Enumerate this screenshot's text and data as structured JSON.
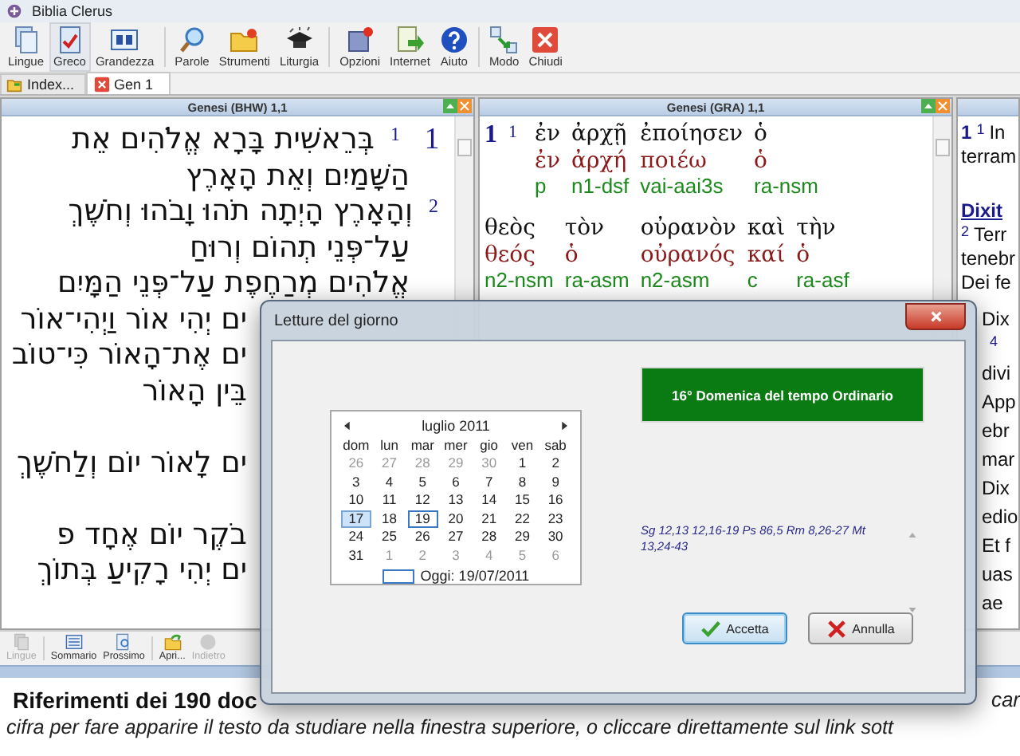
{
  "window": {
    "title": "Biblia Clerus"
  },
  "toolbar": {
    "groups": [
      [
        {
          "label": "Lingue",
          "pressed": false
        },
        {
          "label": "Greco",
          "pressed": true
        },
        {
          "label": "Grandezza",
          "pressed": false
        }
      ],
      [
        {
          "label": "Parole",
          "pressed": false
        },
        {
          "label": "Strumenti",
          "pressed": false
        },
        {
          "label": "Liturgia",
          "pressed": false
        }
      ],
      [
        {
          "label": "Opzioni",
          "pressed": false
        },
        {
          "label": "Internet",
          "pressed": false
        },
        {
          "label": "Aiuto",
          "pressed": false
        }
      ],
      [
        {
          "label": "Modo",
          "pressed": false
        },
        {
          "label": "Chiudi",
          "pressed": false
        }
      ]
    ]
  },
  "tabs": [
    {
      "label": "Index...",
      "selected": false
    },
    {
      "label": "Gen 1",
      "selected": true
    }
  ],
  "hebrew_panel": {
    "title": "Genesi (BHW) 1,1",
    "lines": [
      {
        "kind": "full",
        "chapter": "1",
        "verse": "1",
        "text": "בְּרֵאשִׁית בָּרָא אֱלֹהִים אֵת"
      },
      {
        "kind": "full",
        "text": "הַשָּׁמַיִם וְאֵת הָאָרֶץ"
      },
      {
        "kind": "full",
        "verse": "2",
        "text": "וְהָאָרֶץ הָיְתָה תֹהוּ וָבֹהוּ וְחֹשֶׁךְ"
      },
      {
        "kind": "full",
        "text": "עַל־פְּנֵי תְהוֹם וְרוּחַ"
      },
      {
        "kind": "full",
        "text": "אֱלֹהִים מְרַחֶפֶת עַל־פְּנֵי הַמָּיִם"
      },
      {
        "kind": "partial",
        "text": "ים יְהִי אוֹר וַיְהִי־אוֹר"
      },
      {
        "kind": "partial",
        "text": "ים אֶת־הָאוֹר כִּי־טוֹב"
      },
      {
        "kind": "partial",
        "text": "בֵּין הָאוֹר"
      },
      {
        "kind": "blank"
      },
      {
        "kind": "partial",
        "text": "ים לָאוֹר יוֹם וְלַחֹשֶׁךְ"
      },
      {
        "kind": "blank"
      },
      {
        "kind": "partial",
        "text": "בֹקֶר יוֹם אֶחָד פ"
      },
      {
        "kind": "partial",
        "text": "ים יְהִי רָקִיעַ בְּתוֹךְ"
      }
    ]
  },
  "greek_panel": {
    "title": "Genesi (GRA) 1,1",
    "groups": [
      {
        "chapter": "1",
        "verse": "1",
        "words": [
          {
            "form": "ἐν",
            "lemma": "ἐν",
            "parse": "p"
          },
          {
            "form": "ἀρχῇ",
            "lemma": "ἀρχή",
            "parse": "n1-dsf"
          },
          {
            "form": "ἐποίησεν",
            "lemma": "ποιέω",
            "parse": "vai-aai3s"
          },
          {
            "form": "ὁ",
            "lemma": "ὁ",
            "parse": "ra-nsm"
          }
        ]
      },
      {
        "words": [
          {
            "form": "θεὸς",
            "lemma": "θεός",
            "parse": "n2-nsm"
          },
          {
            "form": "τὸν",
            "lemma": "ὁ",
            "parse": "ra-asm"
          },
          {
            "form": "οὐρανὸν",
            "lemma": "οὐρανός",
            "parse": "n2-asm"
          },
          {
            "form": "καὶ",
            "lemma": "καί",
            "parse": "c"
          },
          {
            "form": "τὴν",
            "lemma": "ὁ",
            "parse": "ra-asf"
          }
        ]
      }
    ]
  },
  "latin_panel": {
    "lines": [
      {
        "kind": "verse",
        "chapter": "1",
        "verse": "1",
        "text": "In"
      },
      {
        "kind": "text",
        "text": "terram"
      },
      {
        "kind": "heading",
        "text": "Dixit"
      },
      {
        "kind": "verse",
        "verse": "2",
        "text": "Terr"
      },
      {
        "kind": "text",
        "text": "tenebr"
      },
      {
        "kind": "text",
        "text": "Dei fe"
      },
      {
        "kind": "fragment",
        "text": "Dix"
      },
      {
        "kind": "number",
        "text": "4"
      },
      {
        "kind": "fragment",
        "text": "divi"
      },
      {
        "kind": "fragment",
        "text": "App"
      },
      {
        "kind": "fragment",
        "text": "ebr"
      },
      {
        "kind": "fragment",
        "text": "mar"
      },
      {
        "kind": "fragment",
        "text": "Dix"
      },
      {
        "kind": "fragment",
        "text": "edio"
      },
      {
        "kind": "fragment",
        "text": "Et f"
      },
      {
        "kind": "fragment",
        "text": "uas"
      },
      {
        "kind": "fragment",
        "text": "ae"
      }
    ]
  },
  "bottom_toolbar": {
    "groups": [
      [
        {
          "label": "Lingue",
          "disabled": true
        }
      ],
      [
        {
          "label": "Sommario",
          "disabled": false
        },
        {
          "label": "Prossimo",
          "disabled": false
        }
      ],
      [
        {
          "label": "Apri...",
          "disabled": false
        },
        {
          "label": "Indietro",
          "disabled": true
        }
      ]
    ]
  },
  "footer": {
    "heading": "Riferimenti dei 190 doc",
    "heading_tail": "car",
    "text": "cifra per fare apparire il testo da studiare nella finestra superiore, o cliccare direttamente sul link sott"
  },
  "dialog": {
    "title": "Letture del giorno",
    "calendar": {
      "month": "luglio 2011",
      "weekdays": [
        "dom",
        "lun",
        "mar",
        "mer",
        "gio",
        "ven",
        "sab"
      ],
      "weeks": [
        [
          {
            "day": "26",
            "other_month": true,
            "selected": false,
            "today": false
          },
          {
            "day": "27",
            "other_month": true,
            "selected": false,
            "today": false
          },
          {
            "day": "28",
            "other_month": true,
            "selected": false,
            "today": false
          },
          {
            "day": "29",
            "other_month": true,
            "selected": false,
            "today": false
          },
          {
            "day": "30",
            "other_month": true,
            "selected": false,
            "today": false
          },
          {
            "day": "1",
            "other_month": false,
            "selected": false,
            "today": false
          },
          {
            "day": "2",
            "other_month": false,
            "selected": false,
            "today": false
          }
        ],
        [
          {
            "day": "3",
            "other_month": false,
            "selected": false,
            "today": false
          },
          {
            "day": "4",
            "other_month": false,
            "selected": false,
            "today": false
          },
          {
            "day": "5",
            "other_month": false,
            "selected": false,
            "today": false
          },
          {
            "day": "6",
            "other_month": false,
            "selected": false,
            "today": false
          },
          {
            "day": "7",
            "other_month": false,
            "selected": false,
            "today": false
          },
          {
            "day": "8",
            "other_month": false,
            "selected": false,
            "today": false
          },
          {
            "day": "9",
            "other_month": false,
            "selected": false,
            "today": false
          }
        ],
        [
          {
            "day": "10",
            "other_month": false,
            "selected": false,
            "today": false
          },
          {
            "day": "11",
            "other_month": false,
            "selected": false,
            "today": false
          },
          {
            "day": "12",
            "other_month": false,
            "selected": false,
            "today": false
          },
          {
            "day": "13",
            "other_month": false,
            "selected": false,
            "today": false
          },
          {
            "day": "14",
            "other_month": false,
            "selected": false,
            "today": false
          },
          {
            "day": "15",
            "other_month": false,
            "selected": false,
            "today": false
          },
          {
            "day": "16",
            "other_month": false,
            "selected": false,
            "today": false
          }
        ],
        [
          {
            "day": "17",
            "other_month": false,
            "selected": true,
            "today": false
          },
          {
            "day": "18",
            "other_month": false,
            "selected": false,
            "today": false
          },
          {
            "day": "19",
            "other_month": false,
            "selected": false,
            "today": true
          },
          {
            "day": "20",
            "other_month": false,
            "selected": false,
            "today": false
          },
          {
            "day": "21",
            "other_month": false,
            "selected": false,
            "today": false
          },
          {
            "day": "22",
            "other_month": false,
            "selected": false,
            "today": false
          },
          {
            "day": "23",
            "other_month": false,
            "selected": false,
            "today": false
          }
        ],
        [
          {
            "day": "24",
            "other_month": false,
            "selected": false,
            "today": false
          },
          {
            "day": "25",
            "other_month": false,
            "selected": false,
            "today": false
          },
          {
            "day": "26",
            "other_month": false,
            "selected": false,
            "today": false
          },
          {
            "day": "27",
            "other_month": false,
            "selected": false,
            "today": false
          },
          {
            "day": "28",
            "other_month": false,
            "selected": false,
            "today": false
          },
          {
            "day": "29",
            "other_month": false,
            "selected": false,
            "today": false
          },
          {
            "day": "30",
            "other_month": false,
            "selected": false,
            "today": false
          }
        ],
        [
          {
            "day": "31",
            "other_month": false,
            "selected": false,
            "today": false
          },
          {
            "day": "1",
            "other_month": true,
            "selected": false,
            "today": false
          },
          {
            "day": "2",
            "other_month": true,
            "selected": false,
            "today": false
          },
          {
            "day": "3",
            "other_month": true,
            "selected": false,
            "today": false
          },
          {
            "day": "4",
            "other_month": true,
            "selected": false,
            "today": false
          },
          {
            "day": "5",
            "other_month": true,
            "selected": false,
            "today": false
          },
          {
            "day": "6",
            "other_month": true,
            "selected": false,
            "today": false
          }
        ]
      ],
      "today_label": "Oggi: 19/07/2011"
    },
    "feast": "16° Domenica del tempo Ordinario",
    "readings": "Sg 12,13 12,16-19 Ps 86,5 Rm 8,26-27 Mt 13,24-43",
    "buttons": [
      {
        "kind": "accept",
        "label": "Accetta"
      },
      {
        "kind": "cancel",
        "label": "Annulla"
      }
    ]
  }
}
